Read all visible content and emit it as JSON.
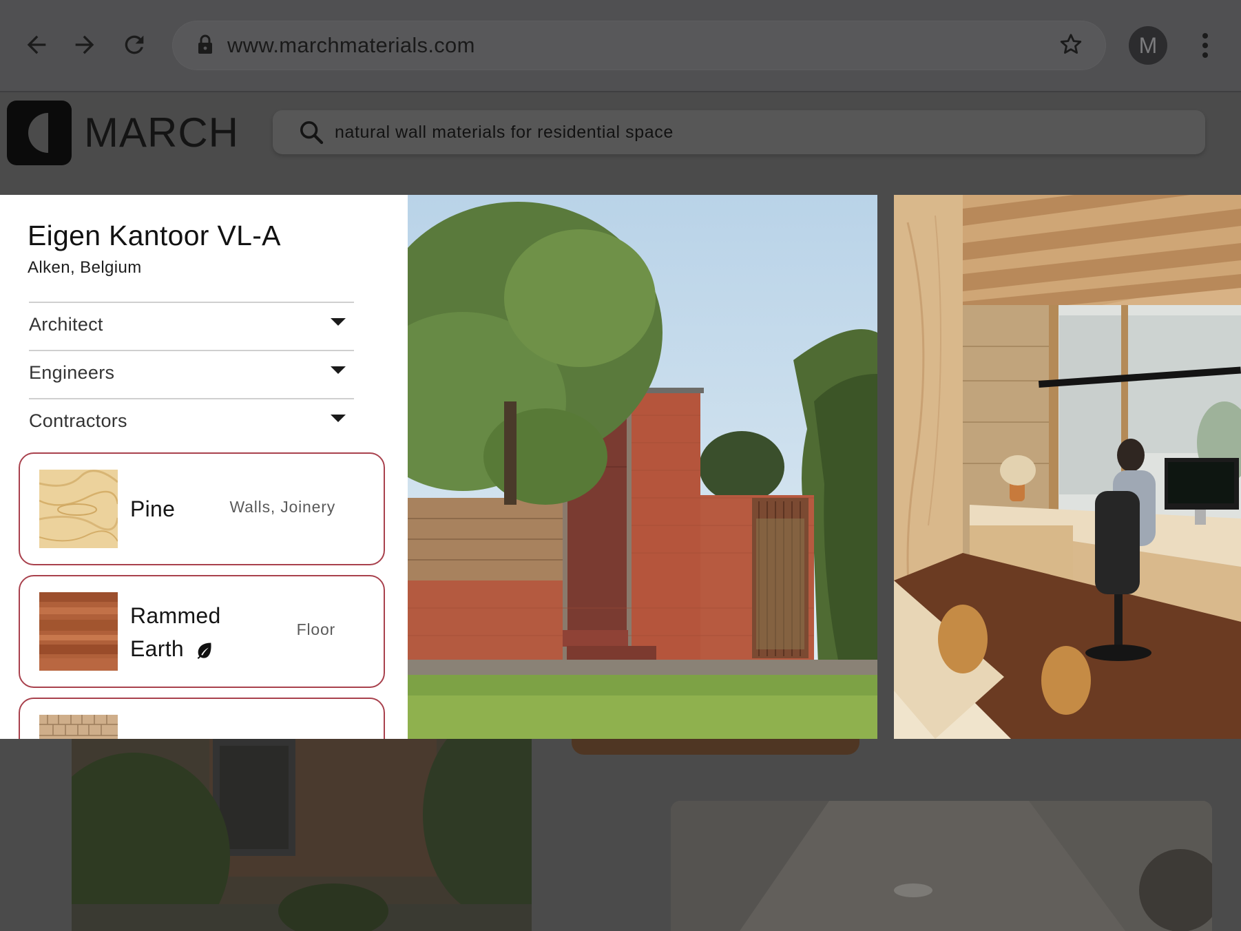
{
  "browser": {
    "url": "www.marchmaterials.com",
    "avatar_letter": "M",
    "icons": [
      "back-icon",
      "forward-icon",
      "reload-icon",
      "lock-icon",
      "star-icon",
      "kebab-menu-icon"
    ]
  },
  "site": {
    "brand": "MARCH",
    "search": {
      "value": "natural wall materials for residential space"
    }
  },
  "project": {
    "title": "Eigen Kantoor VL-A",
    "location": "Alken, Belgium",
    "sections": [
      {
        "label": "Architect"
      },
      {
        "label": "Engineers"
      },
      {
        "label": "Contractors"
      }
    ],
    "materials": [
      {
        "name": "Pine",
        "usage": "Walls, Joinery",
        "sustainable": false
      },
      {
        "name_line1": "Rammed",
        "name_line2": "Earth",
        "usage": "Floor",
        "sustainable": true
      },
      {
        "name": "",
        "usage": ""
      }
    ]
  },
  "colors": {
    "card_border": "#a8404c",
    "panel_bg": "#ffffff",
    "overlay": "#4b4b4b"
  }
}
